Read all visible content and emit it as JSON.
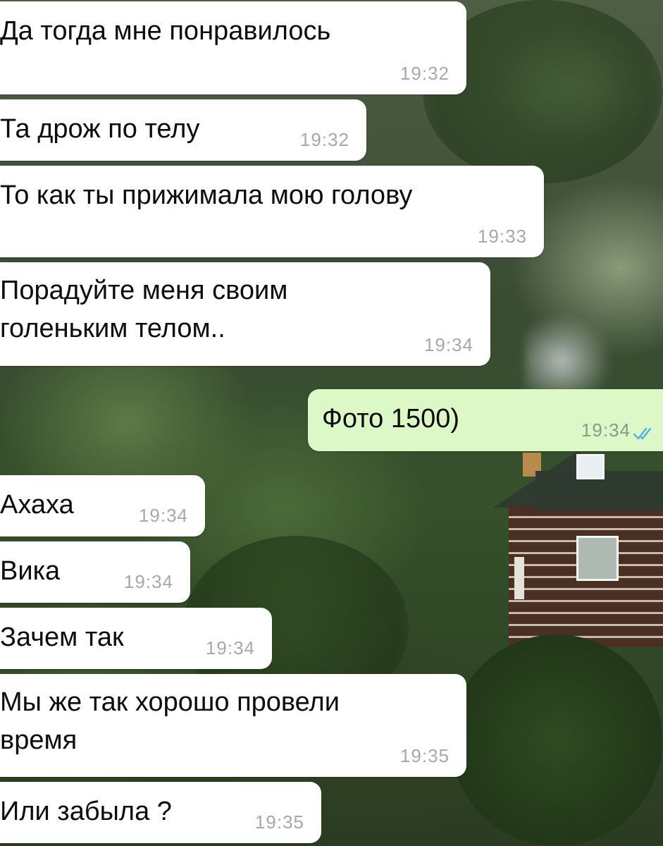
{
  "wallpaper": "forest-cabin",
  "colors": {
    "incoming_bubble": "#ffffff",
    "outgoing_bubble": "#dcf8c6",
    "timestamp": "#a8a8a8",
    "read_ticks": "#4fb3e8"
  },
  "messages": [
    {
      "text": "Да тогда мне понравилось",
      "time": "19:32",
      "direction": "incoming"
    },
    {
      "text": "Та дрож по телу",
      "time": "19:32",
      "direction": "incoming"
    },
    {
      "text": "То как ты прижимала мою голову",
      "time": "19:33",
      "direction": "incoming"
    },
    {
      "lines": [
        "Порадуйте меня своим",
        "голеньким телом.."
      ],
      "time": "19:34",
      "direction": "incoming"
    },
    {
      "text": "Фото 1500)",
      "time": "19:34",
      "direction": "outgoing",
      "status": "read",
      "status_icon": "double-check-icon"
    },
    {
      "text": "Ахаха",
      "time": "19:34",
      "direction": "incoming"
    },
    {
      "text": "Вика",
      "time": "19:34",
      "direction": "incoming"
    },
    {
      "text": "Зачем так",
      "time": "19:34",
      "direction": "incoming"
    },
    {
      "lines": [
        "Мы же так хорошо провели",
        "время"
      ],
      "time": "19:35",
      "direction": "incoming"
    },
    {
      "text": "Или забыла ?",
      "time": "19:35",
      "direction": "incoming"
    }
  ]
}
